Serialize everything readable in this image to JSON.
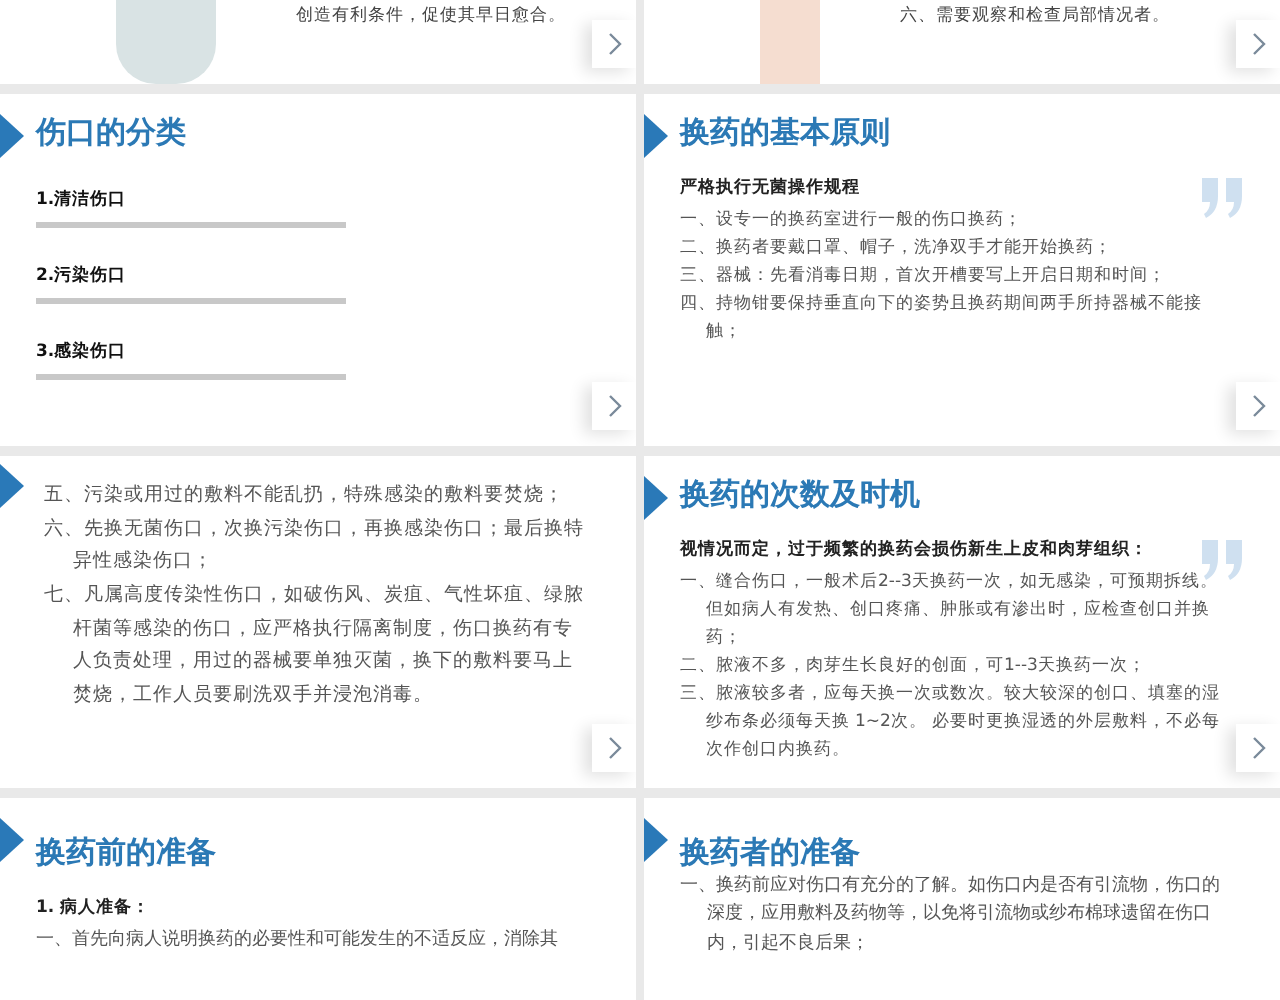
{
  "slides": [
    {
      "kind": "figure-text",
      "next_button": true,
      "lines": [
        "创造有利条件，促使其早日愈合。"
      ]
    },
    {
      "kind": "figure-text",
      "next_button": true,
      "lines": [
        "六、需要观察和检查局部情况者。"
      ]
    },
    {
      "kind": "categories",
      "next_button": true,
      "title": "伤口的分类",
      "categories": [
        {
          "heading": "1.清洁伤口"
        },
        {
          "heading": "2.污染伤口"
        },
        {
          "heading": "3.感染伤口"
        }
      ]
    },
    {
      "kind": "list",
      "next_button": true,
      "quote_mark": true,
      "title": "换药的基本原则",
      "lead": "严格执行无菌操作规程",
      "items": [
        "一、设专一的换药室进行一般的伤口换药；",
        "二、换药者要戴口罩、帽子，洗净双手才能开始换药；",
        "三、器械：先看消毒日期，首次开槽要写上开启日期和时间；",
        "四、持物钳要保持垂直向下的姿势且换药期间两手所持器械不能接触；"
      ]
    },
    {
      "kind": "list",
      "next_button": true,
      "quote_mark": false,
      "items": [
        "五、污染或用过的敷料不能乱扔，特殊感染的敷料要焚烧；",
        "六、先换无菌伤口，次换污染伤口，再换感染伤口；最后换特异性感染伤口；",
        "七、凡属高度传染性伤口，如破伤风、炭疽、气性坏疽、绿脓杆菌等感染的伤口，应严格执行隔离制度，伤口换药有专人负责处理，用过的器械要单独灭菌，换下的敷料要马上焚烧，工作人员要刷洗双手并浸泡消毒。"
      ]
    },
    {
      "kind": "list",
      "next_button": true,
      "quote_mark": true,
      "title": "换药的次数及时机",
      "lead": "视情况而定，过于频繁的换药会损伤新生上皮和肉芽组织：",
      "items": [
        "一、缝合伤口，一般术后2--3天换药一次，如无感染，可预期拆线。但如病人有发热、创口疼痛、肿胀或有渗出时，应检查创口并换药；",
        "二、脓液不多，肉芽生长良好的创面，可1--3天换药一次；",
        "三、脓液较多者，应每天换一次或数次。较大较深的创口、填塞的湿纱布条必须每天换 1~2次。 必要时更换湿透的外层敷料，不必每次作创口内换药。"
      ]
    },
    {
      "kind": "list",
      "next_button": false,
      "quote_mark": false,
      "title": "换药前的准备",
      "lead": "1. 病人准备：",
      "items": [
        "一、首先向病人说明换药的必要性和可能发生的不适反应，消除其"
      ]
    },
    {
      "kind": "list",
      "next_button": false,
      "quote_mark": false,
      "title": "换药者的准备",
      "items": [
        "一、换药前应对伤口有充分的了解。如伤口内是否有引流物，伤口的深度，应用敷料及药物等，以免将引流物或纱布棉球遗留在伤口内，引起不良后果；"
      ]
    }
  ]
}
